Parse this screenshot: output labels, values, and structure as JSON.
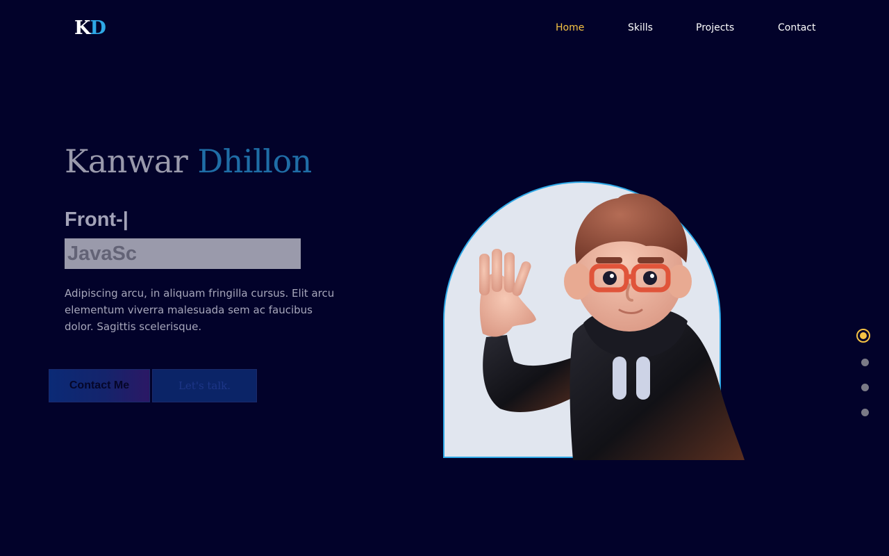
{
  "logo": {
    "k": "K",
    "d": "D"
  },
  "nav": {
    "items": [
      {
        "label": "Home",
        "active": true
      },
      {
        "label": "Skills",
        "active": false
      },
      {
        "label": "Projects",
        "active": false
      },
      {
        "label": "Contact",
        "active": false
      }
    ]
  },
  "hero": {
    "first_name": "Kanwar",
    "last_name": "Dhillon",
    "role_typed": "Front-|",
    "highlight_text": "JavaSc",
    "description": "Adipiscing arcu, in aliquam fringilla cursus. Elit arcu elementum viverra malesuada sem ac faucibus dolor. Sagittis scelerisque.",
    "contact_button": "Contact Me",
    "talk_button": "Let's talk."
  },
  "pagination": {
    "count": 4,
    "active_index": 0
  },
  "colors": {
    "background": "#02022a",
    "accent_yellow": "#f6c344",
    "accent_blue": "#2ea8e6",
    "name_blue": "#1f6da6"
  },
  "icons": {
    "avatar": "waving-3d-character-illustration"
  }
}
